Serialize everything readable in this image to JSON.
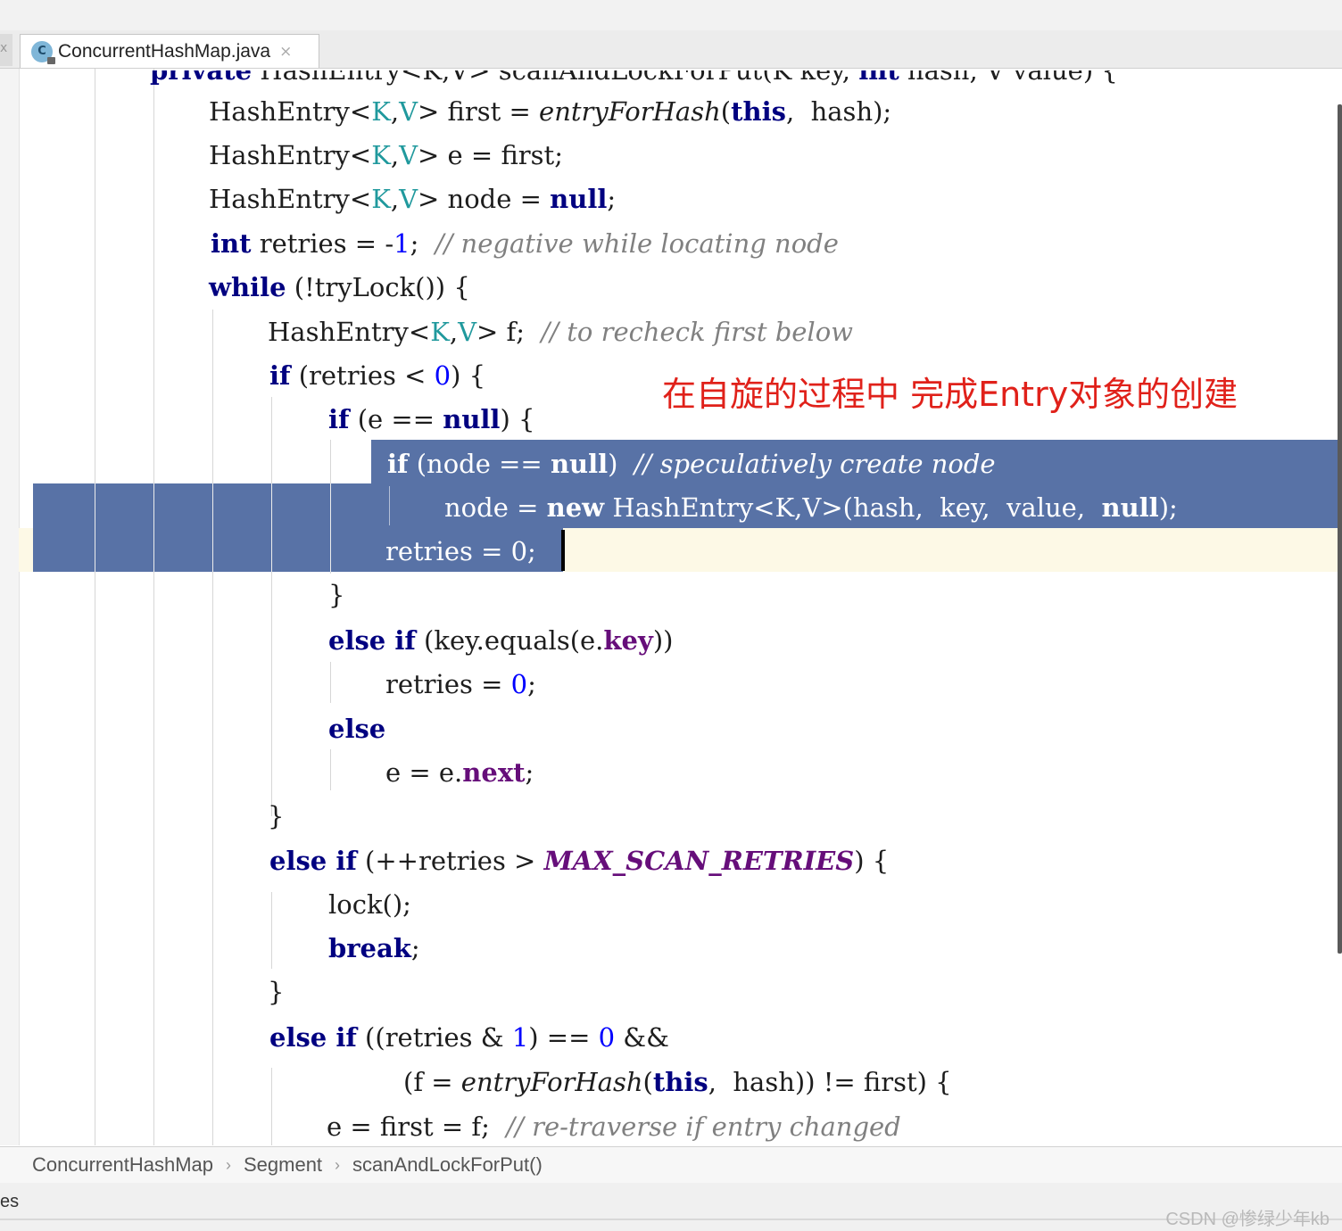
{
  "tab": {
    "title": "ConcurrentHashMap.java",
    "close": "×",
    "icon_letter": "C"
  },
  "left_stub": "x",
  "annotation": "在自旋的过程中 完成Entry对象的创建",
  "breadcrumb": {
    "items": [
      "ConcurrentHashMap",
      "Segment",
      "scanAndLockForPut()"
    ],
    "sep": "›"
  },
  "status": {
    "left": "es",
    "watermark": "CSDN @惨绿少年kb"
  },
  "code": {
    "l0": {
      "kw1": "private",
      "t1": " HashEntry<K,V> scanAndLockForPut(K key, ",
      "kw2": "int",
      "t2": " hash, V value) {"
    },
    "l1": {
      "t1": "HashEntry<",
      "K": "K",
      "c": ",",
      "V": "V",
      "t2": "> first = ",
      "fn": "entryForHash",
      "t3": "(",
      "kw": "this",
      "t4": ",  hash);"
    },
    "l2": {
      "t1": "HashEntry<",
      "K": "K",
      "c": ",",
      "V": "V",
      "t2": "> e = first;"
    },
    "l3": {
      "t1": "HashEntry<",
      "K": "K",
      "c": ",",
      "V": "V",
      "t2": "> node = ",
      "kw": "null",
      "t3": ";"
    },
    "l4": {
      "kw": "int",
      "t1": " retries = -",
      "num": "1",
      "t2": ";  ",
      "cm": "// negative while locating node"
    },
    "l5": {
      "kw": "while",
      "t1": " (!tryLock()) {"
    },
    "l6": {
      "t1": "HashEntry<",
      "K": "K",
      "c": ",",
      "V": "V",
      "t2": "> f;  ",
      "cm": "// to recheck first below"
    },
    "l7": {
      "kw": "if",
      "t1": " (retries < ",
      "num": "0",
      "t2": ") {"
    },
    "l8": {
      "kw": "if",
      "t1": " (e == ",
      "kw2": "null",
      "t2": ") {"
    },
    "l9": {
      "kw": "if",
      "t1": " (node == ",
      "kw2": "null",
      "t2": ")  ",
      "cm": "// speculatively create node"
    },
    "l10": {
      "t1": "node = ",
      "kw": "new",
      "t2": " HashEntry<K,V>(hash,  key,  value,  ",
      "kw2": "null",
      "t3": ");"
    },
    "l11": {
      "t1": "retries = 0;"
    },
    "l12": {
      "t1": "}"
    },
    "l13": {
      "kw": "else if",
      "t1": " (key.equals(e.",
      "fld": "key",
      "t2": "))"
    },
    "l14": {
      "t1": "retries = ",
      "num": "0",
      "t2": ";"
    },
    "l15": {
      "kw": "else"
    },
    "l16": {
      "t1": "e = e.",
      "fld": "next",
      "t2": ";"
    },
    "l17": {
      "t1": "}"
    },
    "l18": {
      "kw": "else if",
      "t1": " (++retries > ",
      "const": "MAX_SCAN_RETRIES",
      "t2": ") {"
    },
    "l19": {
      "t1": "lock();"
    },
    "l20": {
      "kw": "break",
      "t1": ";"
    },
    "l21": {
      "t1": "}"
    },
    "l22": {
      "kw": "else if",
      "t1": " ((retries & ",
      "num": "1",
      "t2": ") == ",
      "num2": "0",
      "t3": " &&"
    },
    "l23": {
      "t1": "(f = ",
      "fn": "entryForHash",
      "t2": "(",
      "kw": "this",
      "t3": ",  hash)) != first) {"
    },
    "l24": {
      "t1": "e = first = f;  ",
      "cm": "// re-traverse if entry changed"
    }
  }
}
